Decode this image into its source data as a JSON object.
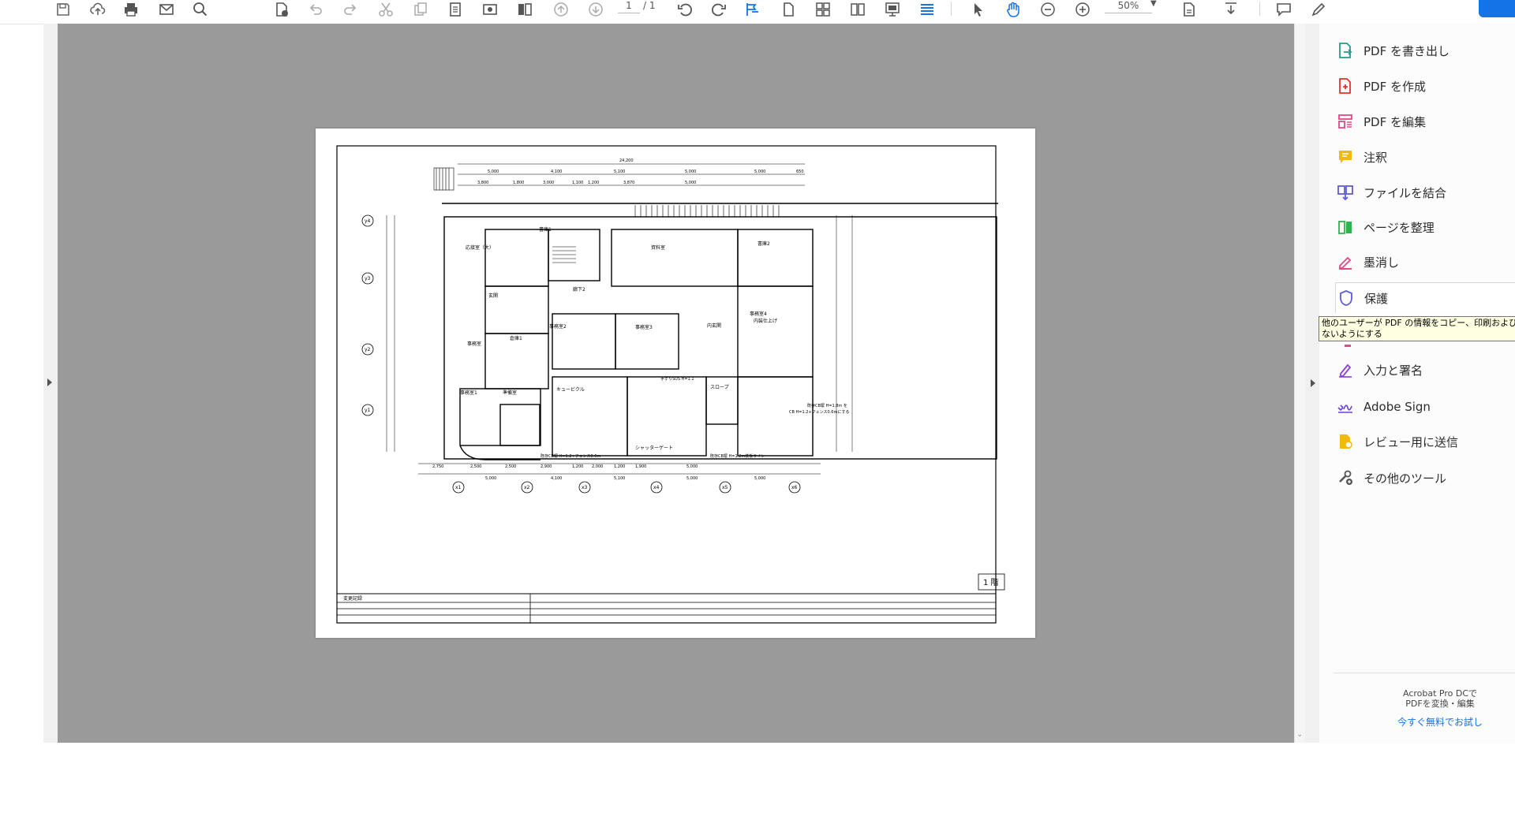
{
  "toolbar": {
    "page_current": "1",
    "page_total": "/ 1",
    "zoom": "50%",
    "icons": [
      "save-icon",
      "upload-cloud-icon",
      "print-icon",
      "email-icon",
      "zoom-search-icon",
      "file-check-icon",
      "undo-icon",
      "redo-icon",
      "cut-icon",
      "copy-icon",
      "document-icon",
      "screenshot-icon",
      "compare-icon",
      "prev-page-icon",
      "next-page-icon",
      "rotate-ccw-icon",
      "rotate-cw-icon",
      "read-mode-icon",
      "single-page-icon",
      "two-page-icon",
      "two-page-scroll-icon",
      "presentation-icon",
      "scrolling-icon",
      "select-pointer-icon",
      "hand-tool-icon",
      "zoom-out-icon",
      "zoom-in-icon",
      "fit-page-icon",
      "download-icon",
      "comment-icon",
      "pen-icon"
    ]
  },
  "tools": [
    {
      "label": "PDF を書き出し",
      "icon": "export-pdf-icon",
      "color": "#1f9d8b"
    },
    {
      "label": "PDF を作成",
      "icon": "create-pdf-icon",
      "color": "#e5322d"
    },
    {
      "label": "PDF を編集",
      "icon": "edit-pdf-icon",
      "color": "#e34886"
    },
    {
      "label": "注釈",
      "icon": "comment-icon",
      "color": "#f2b80c"
    },
    {
      "label": "ファイルを結合",
      "icon": "combine-files-icon",
      "color": "#5f5cd6"
    },
    {
      "label": "ページを整理",
      "icon": "organize-pages-icon",
      "color": "#2fb34a"
    },
    {
      "label": "墨消し",
      "icon": "redact-icon",
      "color": "#e34886"
    },
    {
      "label": "保護",
      "icon": "protect-shield-icon",
      "color": "#5f5cd6"
    },
    {
      "label": "入力と署名",
      "icon": "fill-sign-icon",
      "color": "#8b3fd3"
    },
    {
      "label": "Adobe Sign",
      "icon": "adobe-sign-icon",
      "color": "#6c3fd3"
    },
    {
      "label": "レビュー用に送信",
      "icon": "send-review-icon",
      "color": "#f2b80c"
    },
    {
      "label": "その他のツール",
      "icon": "more-tools-icon",
      "color": "#555555"
    }
  ],
  "tooltip": {
    "line1": "他のユーザーが PDF の情報をコピー、印刷および",
    "line2": "ないようにする"
  },
  "promo": {
    "line1": "Acrobat Pro DCで",
    "line2": "PDFを変換・編集",
    "link": "今すぐ無料でお試し"
  },
  "drawing": {
    "title_block": "1 階",
    "rooms": [
      "応接室（大）",
      "書庫1",
      "資料室",
      "書庫2",
      "廊下2",
      "玄関",
      "事務室",
      "事務室2",
      "事務室3",
      "事務室4",
      "事務室1",
      "準備室",
      "キュービクル",
      "内玄関",
      "スロープ",
      "シャッターゲート",
      "内装仕上げ",
      "倉庫1"
    ],
    "dimensions_top": [
      "24,200",
      "5,000",
      "4,100",
      "5,100",
      "5,000",
      "5,000",
      "650",
      "3,800",
      "1,800",
      "3,000",
      "1,100",
      "1,200",
      "3,870",
      "5,000"
    ],
    "dimensions_bottom": [
      "2,750",
      "2,500",
      "2,500",
      "2,900",
      "1,200",
      "2,000",
      "1,200",
      "1,900",
      "5,000",
      "5,000",
      "4,100",
      "5,100",
      "5,000",
      "5,000"
    ],
    "grid_x": [
      "x1",
      "x2",
      "x3",
      "x4",
      "x5",
      "x6"
    ],
    "grid_y": [
      "y4",
      "y3",
      "y2",
      "y1"
    ],
    "notes": [
      "既存CB塀 H=1.8m を",
      "CB H=1.2+フェンス0.6mにする",
      "既存CB塀 H=1.2+フェンス0.6m",
      "既存CB塀 H=1.2m鉄板ライン",
      "手すりSUS H=1.1"
    ],
    "footer_label": "変更記録"
  }
}
